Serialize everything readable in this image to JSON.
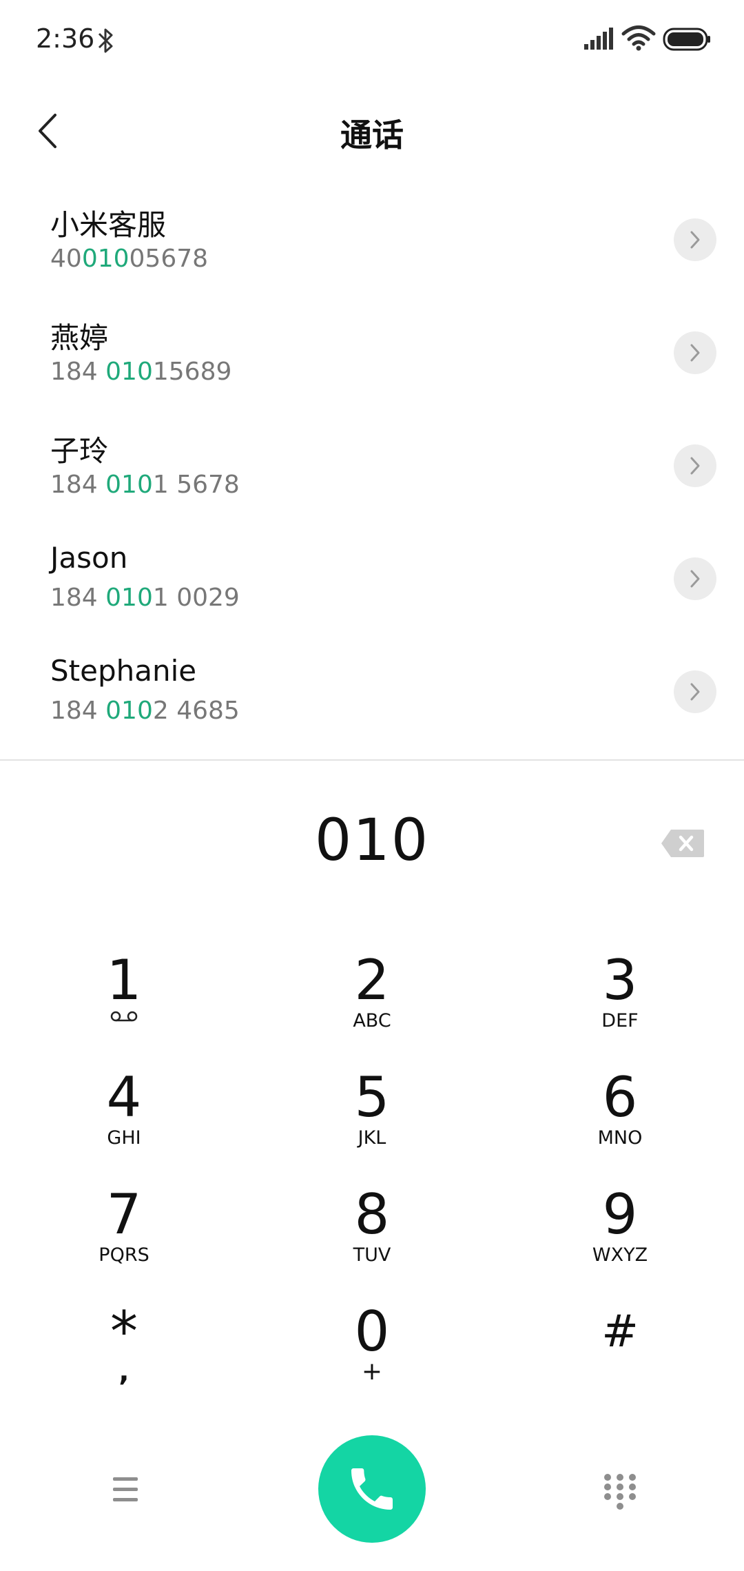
{
  "status_bar": {
    "time": "2:36"
  },
  "header": {
    "title": "通话"
  },
  "contacts": [
    {
      "name": "小米客服",
      "number_pre": "40",
      "number_match": "010",
      "number_post": "05678"
    },
    {
      "name": "燕婷",
      "number_pre": "184 ",
      "number_match": "010",
      "number_post": "15689"
    },
    {
      "name": "子玲",
      "number_pre": "184 ",
      "number_match": "010",
      "number_post": "1 5678"
    },
    {
      "name": "Jason",
      "number_pre": "184 ",
      "number_match": "010",
      "number_post": "1 0029"
    },
    {
      "name": "Stephanie",
      "number_pre": "184 ",
      "number_match": "010",
      "number_post": "2 4685"
    }
  ],
  "dialer": {
    "number": "010"
  },
  "keypad": {
    "keys": [
      {
        "digit": "1",
        "letters": ""
      },
      {
        "digit": "2",
        "letters": "ABC"
      },
      {
        "digit": "3",
        "letters": "DEF"
      },
      {
        "digit": "4",
        "letters": "GHI"
      },
      {
        "digit": "5",
        "letters": "JKL"
      },
      {
        "digit": "6",
        "letters": "MNO"
      },
      {
        "digit": "7",
        "letters": "PQRS"
      },
      {
        "digit": "8",
        "letters": "TUV"
      },
      {
        "digit": "9",
        "letters": "WXYZ"
      },
      {
        "digit": "*",
        "letters": ","
      },
      {
        "digit": "0",
        "letters": "+"
      },
      {
        "digit": "#",
        "letters": ""
      }
    ]
  },
  "colors": {
    "match_highlight": "#1fa97a",
    "call_button": "#14d5a4"
  },
  "icons": {
    "status": [
      "bluetooth-icon",
      "signal-icon",
      "wifi-icon",
      "battery-icon"
    ],
    "voicemail": "voicemail-icon",
    "backspace": "backspace-icon",
    "menu": "menu-icon",
    "call": "phone-icon",
    "keypad": "dialpad-icon"
  }
}
